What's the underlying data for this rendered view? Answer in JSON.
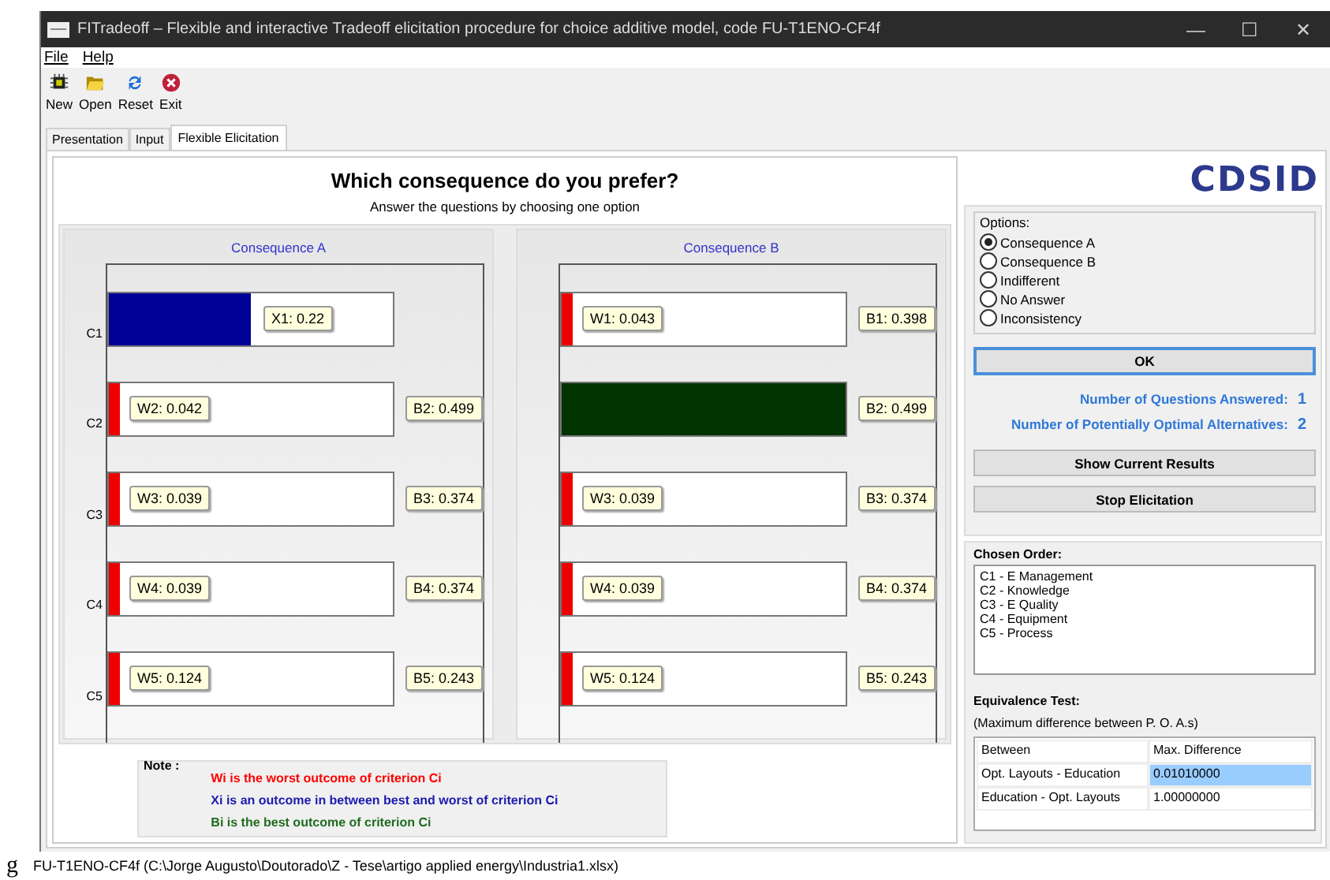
{
  "window": {
    "title": "FITradeoff – Flexible and interactive Tradeoff elicitation procedure for choice additive model, code FU-T1ENO-CF4f",
    "controls": [
      "—",
      "☐",
      "✕"
    ]
  },
  "menu": [
    "File",
    "Help"
  ],
  "toolbar": [
    {
      "label": "New",
      "kind": "new"
    },
    {
      "label": "Open",
      "kind": "open"
    },
    {
      "label": "Reset",
      "kind": "reset"
    },
    {
      "label": "Exit",
      "kind": "exit"
    }
  ],
  "tabs": [
    {
      "label": "Presentation",
      "selected": false
    },
    {
      "label": "Input",
      "selected": false
    },
    {
      "label": "Flexible Elicitation",
      "selected": true
    }
  ],
  "question": {
    "title": "Which consequence do you prefer?",
    "subtitle": "Answer the questions by choosing one option"
  },
  "consequences": [
    {
      "title": "Consequence A",
      "rows": [
        {
          "criterion": "C1",
          "kind": "between",
          "level": 0.5,
          "label": "X1: 0.22"
        },
        {
          "criterion": "C2",
          "kind": "worst",
          "level": 0.04,
          "label": "W2: 0.042",
          "best_label": "B2: 0.499"
        },
        {
          "criterion": "C3",
          "kind": "worst",
          "level": 0.04,
          "label": "W3: 0.039",
          "best_label": "B3: 0.374"
        },
        {
          "criterion": "C4",
          "kind": "worst",
          "level": 0.04,
          "label": "W4: 0.039",
          "best_label": "B4: 0.374"
        },
        {
          "criterion": "C5",
          "kind": "worst",
          "level": 0.04,
          "label": "W5: 0.124",
          "best_label": "B5: 0.243"
        }
      ]
    },
    {
      "title": "Consequence B",
      "rows": [
        {
          "kind": "worst",
          "level": 0.04,
          "label": "W1: 0.043",
          "best_label": "B1: 0.398"
        },
        {
          "kind": "best",
          "level": 1,
          "best_label": "B2: 0.499"
        },
        {
          "kind": "worst",
          "level": 0.04,
          "label": "W3: 0.039",
          "best_label": "B3: 0.374"
        },
        {
          "kind": "worst",
          "level": 0.04,
          "label": "W4: 0.039",
          "best_label": "B4: 0.374"
        },
        {
          "kind": "worst",
          "level": 0.04,
          "label": "W5: 0.124",
          "best_label": "B5: 0.243"
        }
      ]
    }
  ],
  "note": {
    "title": "Note :",
    "lines": [
      {
        "text": "Wi is the worst outcome of criterion Ci",
        "kind": "worst"
      },
      {
        "text": "Xi is an outcome in between best and worst of criterion Ci",
        "kind": "between"
      },
      {
        "text": "Bi is the best outcome of criterion Ci",
        "kind": "best"
      }
    ]
  },
  "logo": {
    "text": "CDSID"
  },
  "options": {
    "title": "Options:",
    "items": [
      {
        "label": "Consequence A",
        "selected": true
      },
      {
        "label": "Consequence B",
        "selected": false
      },
      {
        "label": "Indifferent",
        "selected": false
      },
      {
        "label": "No Answer",
        "selected": false
      },
      {
        "label": "Inconsistency",
        "selected": false
      }
    ]
  },
  "ok_button": "OK",
  "counts": [
    {
      "label": "Number of Questions Answered:",
      "value": "1"
    },
    {
      "label": "Number of Potentially Optimal Alternatives:",
      "value": "2"
    }
  ],
  "buttons": [
    "Show Current Results",
    "Stop Elicitation"
  ],
  "chosen_order": {
    "title": "Chosen Order:",
    "items": [
      "C1 - E Management",
      "C2 - Knowledge",
      "C3 - E Quality",
      "C4 - Equipment",
      "C5 - Process"
    ]
  },
  "equivalence": {
    "title": "Equivalence Test:",
    "subtitle": "(Maximum difference between P. O. A.s)",
    "columns": [
      "Between",
      "Max. Difference"
    ],
    "rows": [
      {
        "cells": [
          "Opt. Layouts - Education",
          "0.01010000"
        ],
        "selected": true
      },
      {
        "cells": [
          "Education - Opt. Layouts",
          "1.00000000"
        ],
        "selected": false
      }
    ]
  },
  "stray_glyph": "g",
  "status_bar": "FU-T1ENO-CF4f (C:\\Jorge Augusto\\Doutorado\\Z - Tese\\artigo applied energy\\Industria1.xlsx)"
}
